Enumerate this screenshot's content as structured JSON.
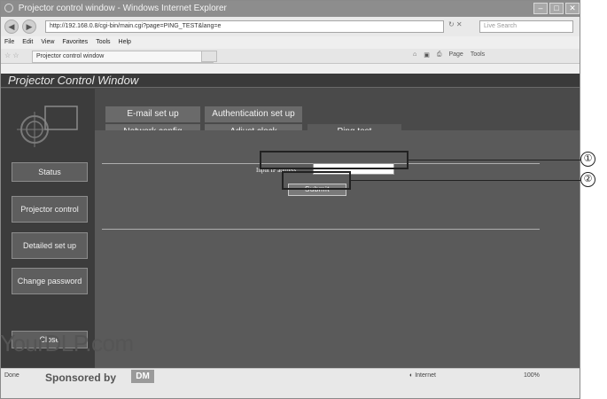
{
  "browser": {
    "window_title": "Projector control window - Windows Internet Explorer",
    "address": "http://192.168.0.8/cgi-bin/main.cgi?page=PING_TEST&lang=e",
    "search_placeholder": "Live Search",
    "menu": [
      "File",
      "Edit",
      "View",
      "Favorites",
      "Tools",
      "Help"
    ],
    "tab_title": "Projector control window",
    "command_bar": [
      "Page",
      "Tools"
    ],
    "status_left": "Done",
    "zone": "Internet",
    "zoom": "100%"
  },
  "app": {
    "title": "Projector Control Window",
    "sidebar": [
      "Status",
      "Projector control",
      "Detailed set up",
      "Change password",
      "Close"
    ],
    "tabs": {
      "row1": [
        "E-mail set up",
        "Authentication set up"
      ],
      "row2": [
        "Network config",
        "Adjust clock",
        "Ping test"
      ],
      "active": "Ping test"
    },
    "form": {
      "ip_label": "Input IP address",
      "ip_value": "",
      "submit_label": "Submit"
    }
  },
  "callouts": [
    "①",
    "②"
  ],
  "watermark": {
    "main": "YourDLP.com",
    "sponsored": "Sponsored by",
    "badge": "DM"
  }
}
